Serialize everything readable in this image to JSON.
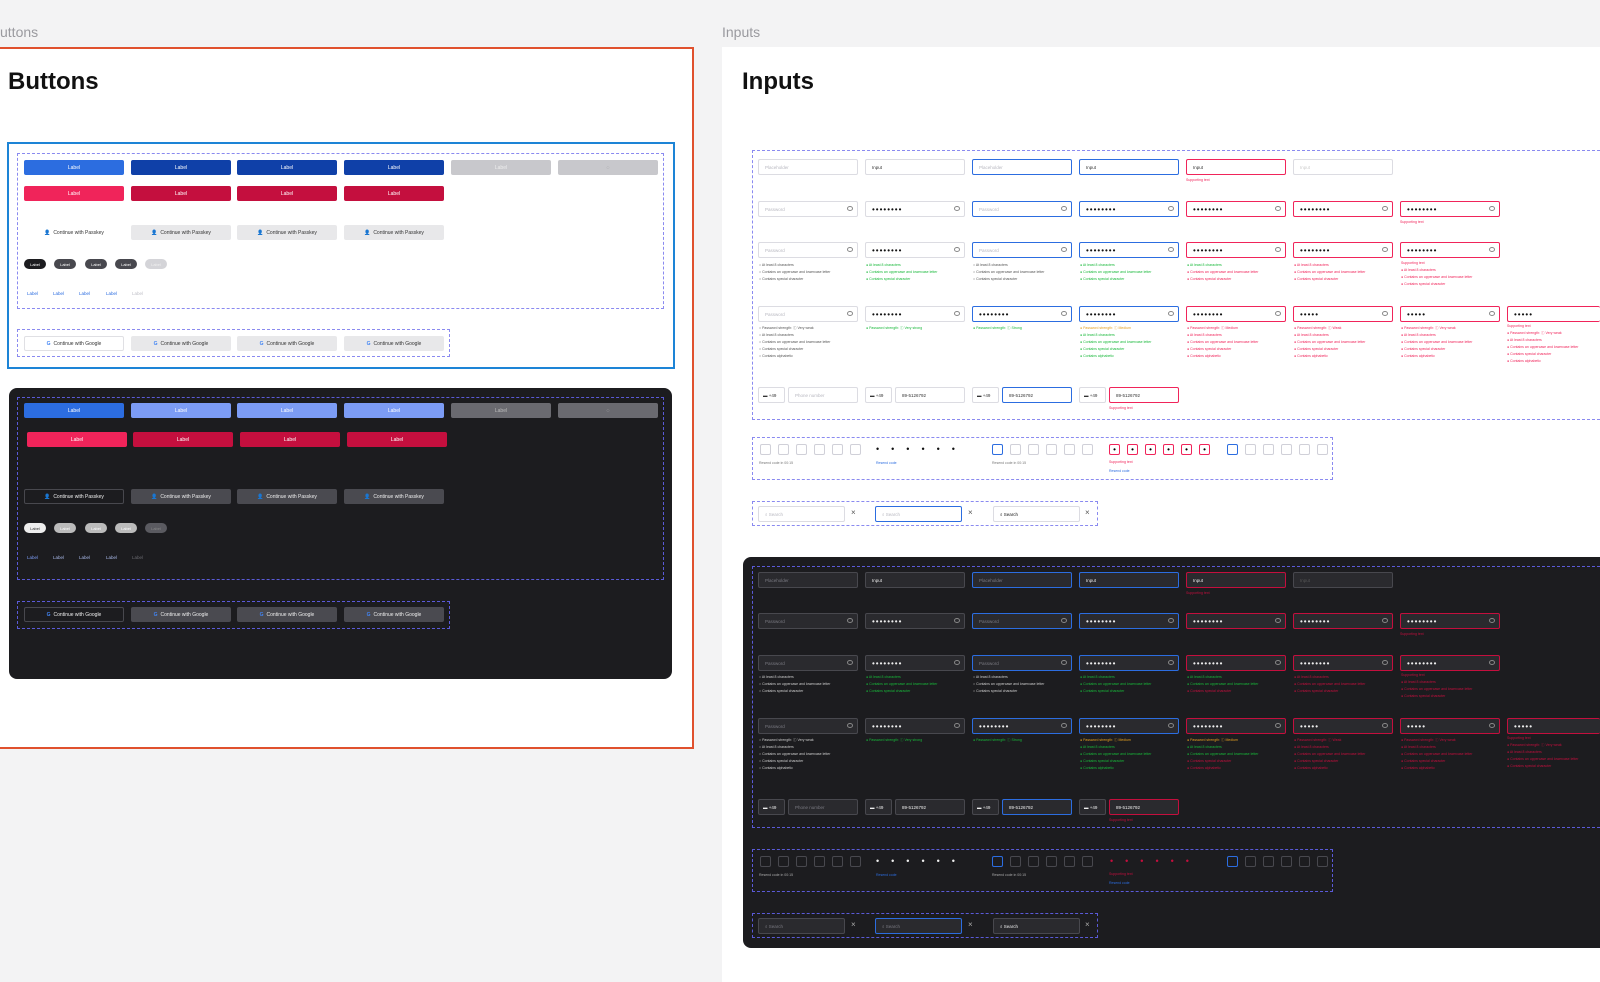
{
  "frames": {
    "buttons_label": "uttons",
    "inputs_label": "Inputs"
  },
  "buttons": {
    "title": "Buttons",
    "label": "Label",
    "passkey": "Continue with Passkey",
    "google": "Continue with Google"
  },
  "inputs": {
    "title": "Inputs",
    "placeholder": "Placeholder",
    "input": "Input",
    "password": "Password",
    "password_dots": "••••••••",
    "password_dots_short": "•••••",
    "supporting_text": "Supporting text",
    "req_8": "At least 8 characters",
    "req_case": "Contains an uppercase and lowercase letter",
    "req_special": "Contains special character",
    "req_alpha": "Contains alphabetic",
    "strength_very_weak": "Password strength: ⓘ Very weak",
    "strength_very_strong": "Password strength: ⓘ Very strong",
    "strength_strong": "Password strength: ⓘ Strong",
    "strength_medium": "Password strength: ⓘ Medium",
    "strength_weak": "Password strength: ⓘ Weak",
    "country_code": "+49",
    "phone_placeholder": "Phone number",
    "phone_value": "89-5126792",
    "resend_timer": "Resend code in 00:15",
    "resend_code": "Resend code",
    "search": "Search"
  },
  "colors": {
    "primary": "#2c6de0",
    "primary_dark": "#0f40a8",
    "primary_light": "#7c9cf5",
    "danger": "#f0245a",
    "danger_dark": "#c40f3e",
    "success": "#18b83a",
    "warning": "#e6a020",
    "selection_orange": "#e0512e",
    "selection_blue": "#1d84d6"
  },
  "icons": [
    "passkey-icon",
    "google-icon",
    "eye-off-icon",
    "search-icon",
    "close-icon",
    "spinner-icon",
    "flag-de-icon"
  ]
}
